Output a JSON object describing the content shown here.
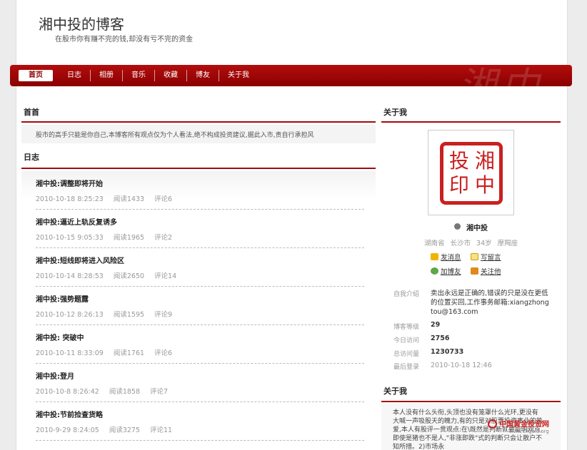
{
  "blog": {
    "title": "湘中投的博客",
    "subtitle": "在股市你有赚不完的钱,却没有亏不完的资金"
  },
  "nav": {
    "items": [
      "首页",
      "日志",
      "相册",
      "音乐",
      "收藏",
      "博友",
      "关于我"
    ],
    "active": "首页"
  },
  "main": {
    "home_heading": "首首",
    "notice": "股市的高手只能是你自己,本博客所有观点仅为个人看法,绝不构成投资建议,据此入市,责自行承担风",
    "diary_heading": "日志",
    "posts": [
      {
        "title": "湘中投:调整即将开始",
        "date": "2010-10-18 8:25:23",
        "reads": "阅读1433",
        "comments": "评论6"
      },
      {
        "title": "湘中投:逼近上轨反复诱多",
        "date": "2010-10-15 9:05:33",
        "reads": "阅读1965",
        "comments": "评论2"
      },
      {
        "title": "湘中投:短线即将进入风险区",
        "date": "2010-10-14 8:28:53",
        "reads": "阅读2650",
        "comments": "评论14"
      },
      {
        "title": "湘中投:强势题露",
        "date": "2010-10-12 8:26:13",
        "reads": "阅读1595",
        "comments": "评论9"
      },
      {
        "title": "湘中投: 突破中",
        "date": "2010-10-11 8:33:09",
        "reads": "阅读1761",
        "comments": "评论6"
      },
      {
        "title": "湘中投:登月",
        "date": "2010-10-8 8:26:42",
        "reads": "阅读1858",
        "comments": "评论7"
      },
      {
        "title": "湘中投:节前捡查货略",
        "date": "2010-9-29 8:24:05",
        "reads": "阅读3275",
        "comments": "评论11"
      }
    ]
  },
  "sidebar": {
    "about_heading": "关于我",
    "avatar": {
      "chars": [
        "湘",
        "中",
        "投",
        "印"
      ]
    },
    "name": "湘中投",
    "location": [
      "湖南省",
      "长沙市",
      "34岁",
      "摩羯座"
    ],
    "actions": {
      "send_message": "发消息",
      "write_message": "写留言",
      "add_friend": "加博友",
      "follow": "关注他"
    },
    "info": {
      "intro_label": "自我介绍",
      "intro_value": "卖出永远是正确的,错误的只是没在更低的位置买回,工作事务邮箱:xiangzhongtou@163.com",
      "level_label": "博客等级",
      "level_value": "29",
      "today_label": "今日访问",
      "today_value": "2756",
      "total_label": "总访问量",
      "total_value": "1230733",
      "last_login_label": "最后登录",
      "last_login_value": "2010-10-18 12:46"
    },
    "about2_heading": "关于我",
    "about2_text": "本人没有什么头衔,头顶也没有笼罩什么光环,更没有大喊一声吸股天的魄力,有的只是对股票投资事业的热爱,本人有股评一贯观点:在\\既然是判断就要能明观点,即使是猪也不是人,\"非涨即跌\"式的判断只会让散户不知所措。2)市场永"
  },
  "watermark": {
    "text": "中国黄金投资网",
    "url": "www.cngold.org"
  },
  "colors": {
    "nav_red": "#a40a0a",
    "seal_red": "#c92020"
  }
}
